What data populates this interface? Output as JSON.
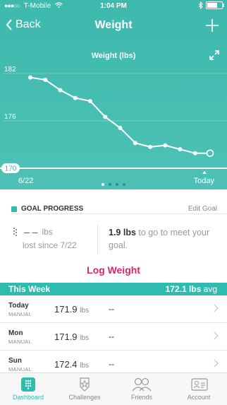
{
  "status_bar": {
    "carrier": "T-Mobile",
    "time": "1:04 PM",
    "battery_level": 0.7
  },
  "nav": {
    "back_label": "Back",
    "title": "Weight",
    "add_icon": "plus-icon"
  },
  "chart": {
    "title": "Weight (lbs)",
    "expand_icon": "expand-arrows-icon",
    "pager": {
      "pages": 4,
      "active": 0
    }
  },
  "chart_data": {
    "type": "line",
    "title": "Weight (lbs)",
    "y_ticks": [
      182,
      176,
      170
    ],
    "ylim": [
      170,
      182
    ],
    "goal_value": 170,
    "x_start_label": "6/22",
    "x_end_label": "Today",
    "series": [
      {
        "values": [
          181.5,
          181.2,
          179.9,
          178.9,
          178.5,
          176.5,
          175.1,
          173.2,
          172.7,
          172.9,
          172.4,
          171.9,
          171.9
        ]
      }
    ],
    "colors": {
      "line": "#ffffff",
      "background": "#3db9ad"
    }
  },
  "goal": {
    "heading": "GOAL PROGRESS",
    "edit_label": "Edit Goal",
    "lost_value": "– –",
    "lost_unit": "lbs",
    "lost_since": "lost since 7/22",
    "to_go_value": "1.9 lbs",
    "to_go_text": "to go to meet your goal.",
    "log_button": "Log Weight"
  },
  "week": {
    "label": "This Week",
    "avg_value": "172.1 lbs",
    "avg_suffix": "avg",
    "rows": [
      {
        "day": "Today",
        "type": "MANUAL",
        "weight": "171.9",
        "unit": "lbs",
        "fat": "--"
      },
      {
        "day": "Mon",
        "type": "MANUAL",
        "weight": "171.9",
        "unit": "lbs",
        "fat": "--"
      },
      {
        "day": "Sun",
        "type": "MANUAL",
        "weight": "172.4",
        "unit": "lbs",
        "fat": "--"
      }
    ]
  },
  "tabs": [
    {
      "label": "Dashboard",
      "icon": "dashboard-grid-icon",
      "active": true
    },
    {
      "label": "Challenges",
      "icon": "star-badge-icon",
      "active": false
    },
    {
      "label": "Friends",
      "icon": "friends-icon",
      "active": false
    },
    {
      "label": "Account",
      "icon": "account-card-icon",
      "active": false
    }
  ],
  "colors": {
    "accent": "#2fbcb0",
    "log_weight": "#d8266d"
  }
}
